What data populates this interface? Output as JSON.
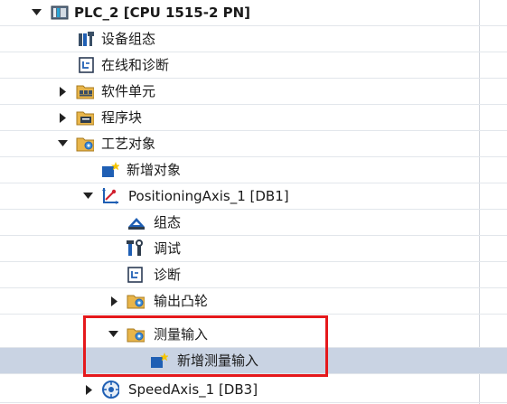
{
  "tree": {
    "items": [
      {
        "label": "PLC_2 [CPU 1515-2 PN]",
        "icon": "plc-cpu-icon",
        "expander": "expanded"
      },
      {
        "label": "设备组态",
        "icon": "device-config-icon",
        "expander": "none"
      },
      {
        "label": "在线和诊断",
        "icon": "online-diagnostics-icon",
        "expander": "none"
      },
      {
        "label": "软件单元",
        "icon": "software-units-folder-icon",
        "expander": "collapsed"
      },
      {
        "label": "程序块",
        "icon": "program-blocks-folder-icon",
        "expander": "collapsed"
      },
      {
        "label": "工艺对象",
        "icon": "technology-objects-folder-icon",
        "expander": "expanded"
      },
      {
        "label": "新增对象",
        "icon": "add-new-object-icon",
        "expander": "none"
      },
      {
        "label": "PositioningAxis_1 [DB1]",
        "icon": "positioning-axis-icon",
        "expander": "expanded"
      },
      {
        "label": "组态",
        "icon": "configuration-icon",
        "expander": "none"
      },
      {
        "label": "调试",
        "icon": "commissioning-icon",
        "expander": "none"
      },
      {
        "label": "诊断",
        "icon": "diagnostics-icon",
        "expander": "none"
      },
      {
        "label": "输出凸轮",
        "icon": "output-cams-folder-icon",
        "expander": "collapsed"
      },
      {
        "label": "测量输入",
        "icon": "measuring-input-folder-icon",
        "expander": "expanded"
      },
      {
        "label": "新增测量输入",
        "icon": "add-measuring-input-icon",
        "expander": "none",
        "selected": true
      },
      {
        "label": "SpeedAxis_1 [DB3]",
        "icon": "speed-axis-icon",
        "expander": "collapsed"
      }
    ]
  },
  "colors": {
    "selection": "#c9d3e3",
    "highlight_box": "#e5191c",
    "folder": "#e8b54a",
    "accent_blue": "#1f5fb4",
    "star": "#f5c400"
  }
}
